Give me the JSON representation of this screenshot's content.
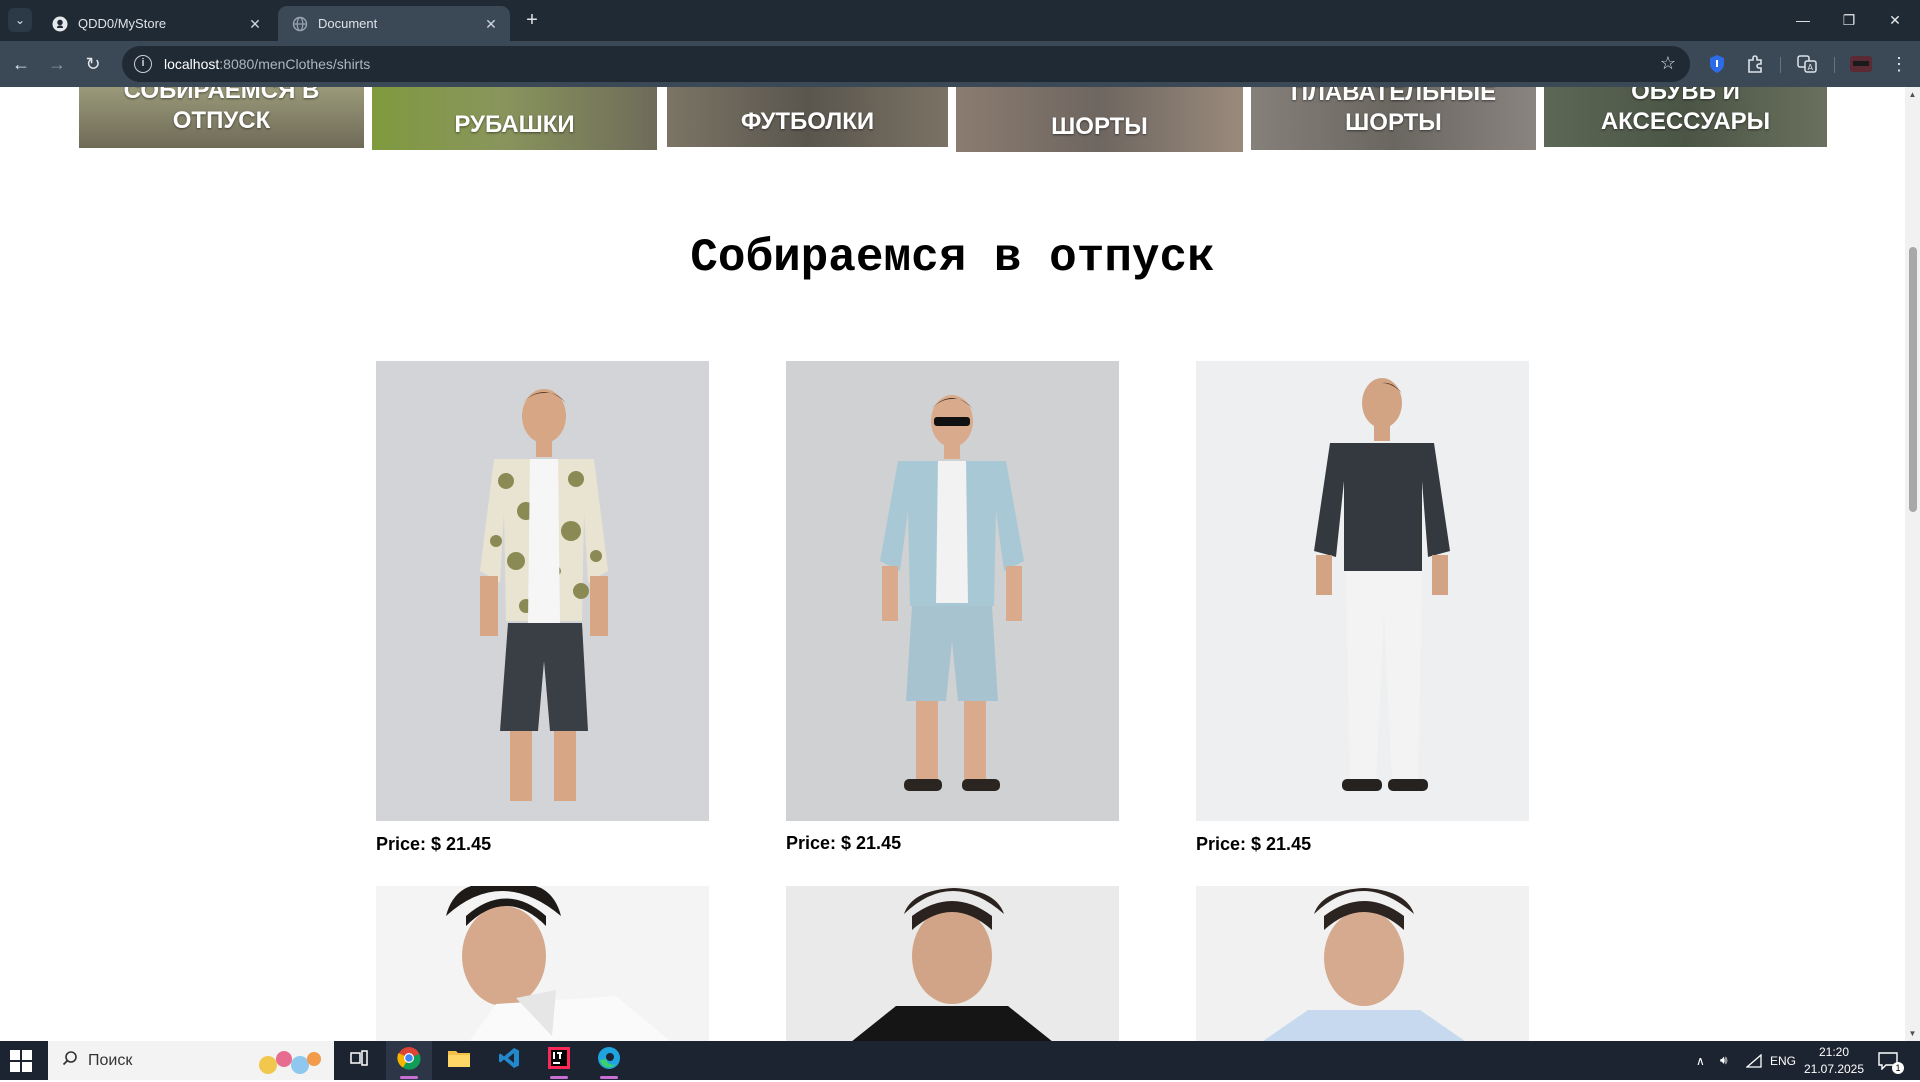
{
  "browser": {
    "tabs": [
      {
        "title": "QDD0/MyStore",
        "icon": "github-icon"
      },
      {
        "title": "Document",
        "icon": "globe-icon"
      }
    ],
    "url_host": "localhost",
    "url_path": ":8080/menClothes/shirts"
  },
  "categories": [
    {
      "label": "СОБИРАЕМСЯ В ОТПУСК",
      "color": "#6f6a57"
    },
    {
      "label": "РУБАШКИ",
      "color": "#6b6d58"
    },
    {
      "label": "ФУТБОЛКИ",
      "color": "#5d5a52"
    },
    {
      "label": "ШОРТЫ",
      "color": "#7a6f66"
    },
    {
      "label": "ПЛАВАТЕЛЬНЫЕ ШОРТЫ",
      "color": "#6e6a64"
    },
    {
      "label": "ОБУВЬ И АКСЕССУАРЫ",
      "color": "#4f5a4e"
    }
  ],
  "section_title": "Собираемся в отпуск",
  "products": [
    {
      "price": "Price: $ 21.45",
      "image": "man-in-floral-shirt-and-dark-shorts"
    },
    {
      "price": "Price: $ 21.45",
      "image": "man-in-light-blue-denim-shirt-and-shorts"
    },
    {
      "price": "Price: $ 21.45",
      "image": "man-in-navy-shirt-and-white-trousers"
    },
    {
      "price": "",
      "image": "man-in-white-shirt-portrait"
    },
    {
      "price": "",
      "image": "man-in-black-shirt-portrait"
    },
    {
      "price": "",
      "image": "man-in-light-blue-shirt-portrait"
    }
  ],
  "taskbar": {
    "search_placeholder": "Поиск",
    "language": "ENG",
    "time": "21:20",
    "date": "21.07.2025",
    "notifications": "1"
  }
}
